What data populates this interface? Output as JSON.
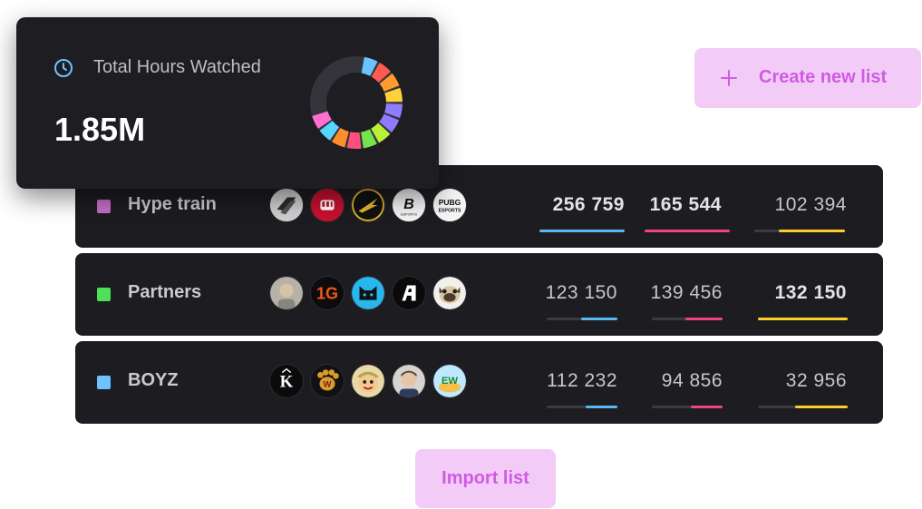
{
  "hours_card": {
    "title": "Total Hours Watched",
    "value": "1.85M",
    "segment_colors": [
      "#69c3ff",
      "#ff5a4f",
      "#ff9a2e",
      "#ffd23a",
      "#8e7dff",
      "#8f79ff",
      "#b8f03a",
      "#74e34c",
      "#ff4f7c",
      "#ff8d2b",
      "#56d6ff",
      "#ff6fd0"
    ]
  },
  "buttons": {
    "create": "Create new list",
    "import": "Import list"
  },
  "lists": [
    {
      "name": "Hype train",
      "swatch": "#c46fc9",
      "stats": [
        "256 759",
        "165 544",
        "102 394"
      ],
      "bold": [
        true,
        true,
        false
      ],
      "fill": [
        1.0,
        1.0,
        0.73
      ],
      "avatars": [
        "team-logo-icon",
        "fist-logo-icon",
        "wing-logo-icon",
        "b-esports-logo-icon",
        "pubg-esports-logo-icon"
      ]
    },
    {
      "name": "Partners",
      "swatch": "#4fe05a",
      "stats": [
        "123 150",
        "139 456",
        "132 150"
      ],
      "bold": [
        false,
        false,
        true
      ],
      "fill": [
        0.52,
        0.52,
        1.0
      ],
      "avatars": [
        "face-avatar-icon",
        "1g-logo-icon",
        "cat-logo-icon",
        "a-logo-icon",
        "pug-avatar-icon"
      ]
    },
    {
      "name": "BOYZ",
      "swatch": "#6ec2ff",
      "stats": [
        "112 232",
        "94 856",
        "32 956"
      ],
      "bold": [
        false,
        false,
        false
      ],
      "fill": [
        0.45,
        0.45,
        0.6
      ],
      "avatars": [
        "k-logo-icon",
        "paw-logo-icon",
        "cartoon-avatar-icon",
        "streamer-avatar-icon",
        "ebw-logo-icon"
      ]
    }
  ],
  "metric_colors": [
    "#58b9f2",
    "#f0457e",
    "#ffcc2e"
  ]
}
